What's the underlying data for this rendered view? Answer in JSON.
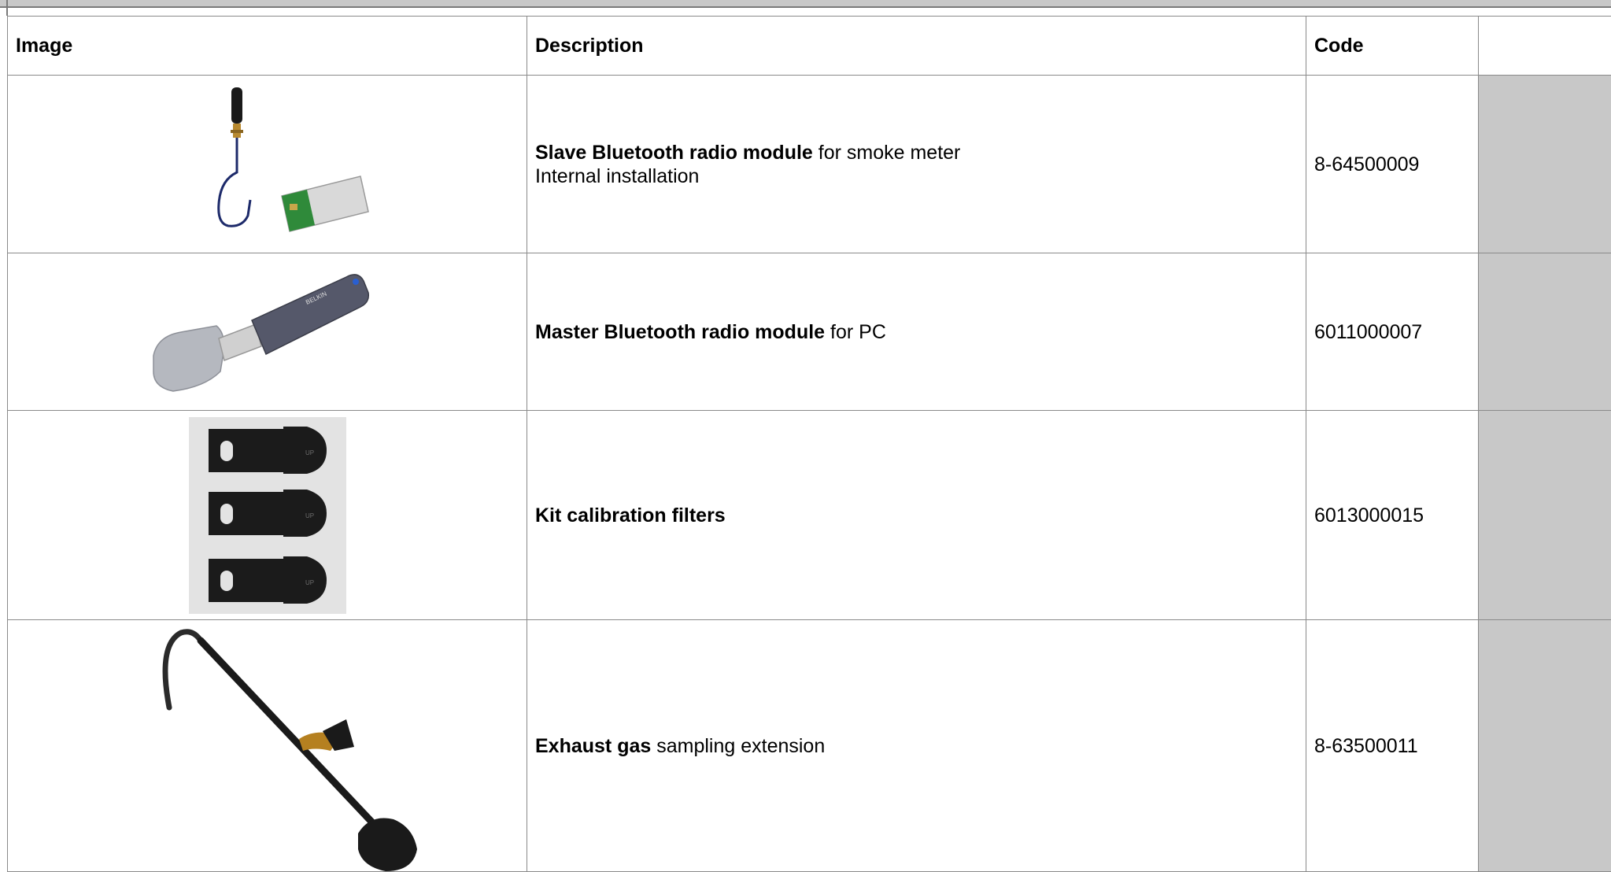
{
  "table": {
    "headers": [
      "Image",
      "Description",
      "Code",
      ""
    ],
    "rows": [
      {
        "image_name": "slave-bluetooth-module-photo",
        "desc_bold": "Slave Bluetooth radio module",
        "desc_rest": " for smoke meter",
        "desc_line2": "Internal installation",
        "code": "8-64500009"
      },
      {
        "image_name": "usb-bluetooth-dongle-photo",
        "desc_bold": "Master Bluetooth radio module",
        "desc_rest": " for PC",
        "desc_line2": "",
        "code": "6011000007",
        "dongle_brand": "BELKIN"
      },
      {
        "image_name": "calibration-filters-photo",
        "desc_bold": "Kit calibration filters",
        "desc_rest": "",
        "desc_line2": "",
        "code": "6013000015",
        "filter_mark": "UP"
      },
      {
        "image_name": "exhaust-sampling-probe-photo",
        "desc_bold": "Exhaust gas",
        "desc_rest": " sampling extension",
        "desc_line2": "",
        "code": "8-63500011"
      }
    ]
  }
}
